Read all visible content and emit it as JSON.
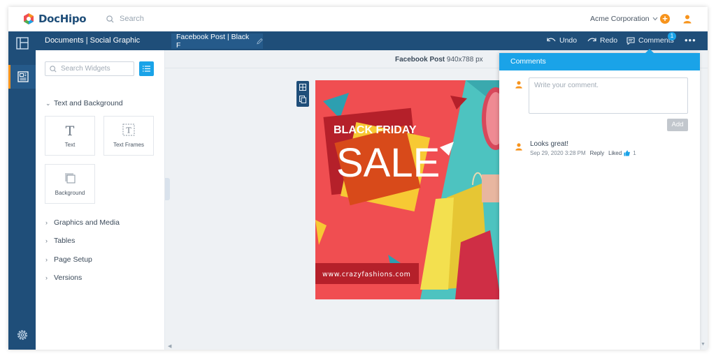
{
  "app": {
    "logo_text": "DocHipo",
    "colors": {
      "brand_blue": "#1f4e79",
      "accent_orange": "#f7941d",
      "accent_cyan": "#1aa3e8"
    }
  },
  "header": {
    "search_placeholder": "Search",
    "account_name": "Acme Corporation",
    "add_icon": "plus-icon",
    "user_icon": "user-icon"
  },
  "toolbar": {
    "panel_title": "Documents | Social Graphic",
    "document_tab": "Facebook Post | Black F",
    "undo_label": "Undo",
    "redo_label": "Redo",
    "comments_label": "Comments",
    "comments_count": "1",
    "more_label": "•••"
  },
  "rail": {
    "items": [
      {
        "name": "layout-icon"
      },
      {
        "name": "document-icon",
        "active": true
      },
      {
        "name": "settings-gear-icon"
      }
    ]
  },
  "widgets": {
    "search_placeholder": "Search Widgets",
    "sections": [
      {
        "label": "Text and Background",
        "expanded": true
      },
      {
        "label": "Graphics and Media",
        "expanded": false
      },
      {
        "label": "Tables",
        "expanded": false
      },
      {
        "label": "Page Setup",
        "expanded": false
      },
      {
        "label": "Versions",
        "expanded": false
      }
    ],
    "tiles": [
      {
        "label": "Text",
        "icon": "text-T-icon"
      },
      {
        "label": "Text Frames",
        "icon": "text-frame-icon"
      },
      {
        "label": "Background",
        "icon": "background-icon"
      }
    ]
  },
  "canvas": {
    "doc_type": "Facebook Post",
    "doc_size": "940x788 px",
    "design": {
      "line1": "BLACK FRIDAY",
      "line2": "SALE",
      "url": "www.crazyfashions.com"
    }
  },
  "comments": {
    "title": "Comments",
    "input_placeholder": "Write your comment.",
    "add_label": "Add",
    "items": [
      {
        "text": "Looks great!",
        "timestamp": "Sep 29, 2020 3:28 PM",
        "reply_label": "Reply",
        "liked_label": "Liked",
        "likes": "1"
      }
    ]
  }
}
